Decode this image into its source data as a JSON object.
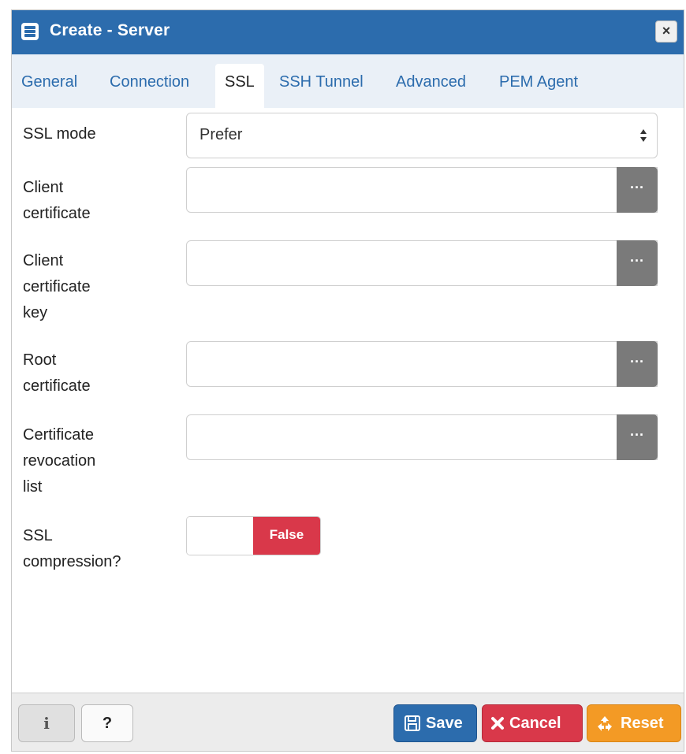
{
  "dialog": {
    "title": "Create - Server",
    "close_label": "×",
    "tabs": [
      {
        "label": "General",
        "active": false
      },
      {
        "label": "Connection",
        "active": false
      },
      {
        "label": "SSL",
        "active": true
      },
      {
        "label": "SSH Tunnel",
        "active": false
      },
      {
        "label": "Advanced",
        "active": false
      },
      {
        "label": "PEM Agent",
        "active": false
      }
    ]
  },
  "form": {
    "ssl_mode": {
      "label": "SSL mode",
      "value": "Prefer"
    },
    "client_certificate": {
      "label_lines": [
        "Client",
        "certificate"
      ],
      "value": "",
      "browse_label": "···"
    },
    "client_certificate_key": {
      "label_lines": [
        "Client",
        "certificate",
        "key"
      ],
      "value": "",
      "browse_label": "···"
    },
    "root_certificate": {
      "label_lines": [
        "Root",
        "certificate"
      ],
      "value": "",
      "browse_label": "···"
    },
    "certificate_revocation_list": {
      "label_lines": [
        "Certificate",
        "revocation",
        "list"
      ],
      "value": "",
      "browse_label": "···"
    },
    "ssl_compression": {
      "label_lines": [
        "SSL",
        "compression?"
      ],
      "value": "False"
    }
  },
  "footer": {
    "info_label": "i",
    "help_label": "?",
    "save_label": "Save",
    "cancel_label": "Cancel",
    "reset_label": "Reset"
  },
  "colors": {
    "titlebar": "#2c6cad",
    "tab_strip": "#eaf0f7",
    "save": "#2c6cad",
    "cancel": "#d9384a",
    "reset": "#f39a25",
    "toggle_false": "#d9384a",
    "browse": "#7a7a7a"
  },
  "icons": {
    "title": "server-icon",
    "close": "close-icon",
    "select": "sort-arrows-icon",
    "save": "floppy-disk-icon",
    "cancel": "x-mark-icon",
    "reset": "recycle-icon"
  }
}
